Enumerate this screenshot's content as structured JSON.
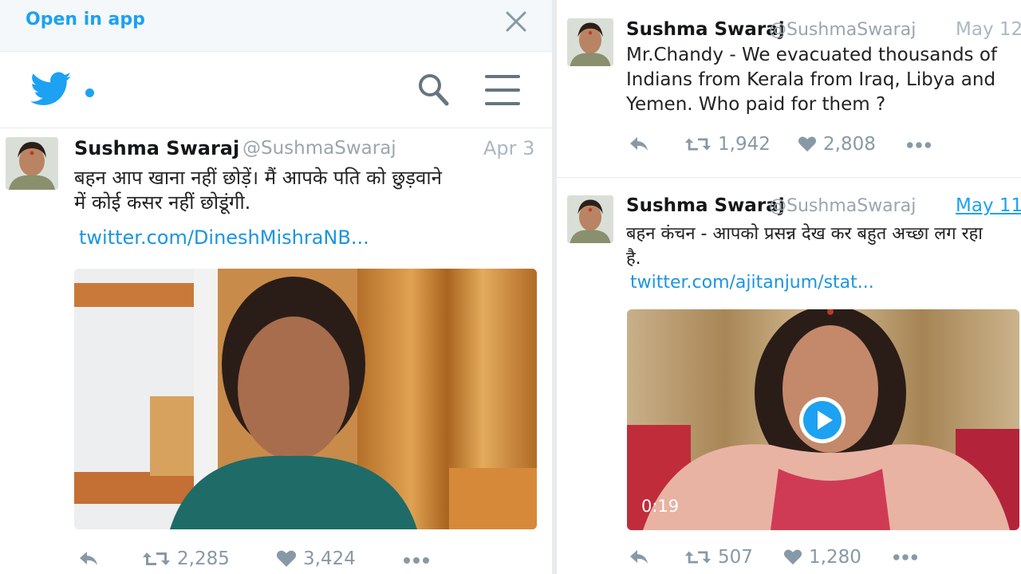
{
  "top_bar": {
    "open_in_app": "Open in app"
  },
  "icons": {
    "close": "close-icon",
    "twitter_bird": "twitter-bird-icon",
    "search": "search-icon",
    "menu": "hamburger-menu-icon",
    "reply": "reply-icon",
    "retweet": "retweet-icon",
    "like": "heart-icon",
    "more": "more-dots-icon",
    "play": "play-icon"
  },
  "colors": {
    "accent": "#1da1f2",
    "link": "#1b95e0",
    "muted": "#8899a6"
  },
  "left_tweet": {
    "author": {
      "name": "Sushma Swaraj",
      "handle": "@SushmaSwaraj"
    },
    "date": "Apr 3",
    "text_line1": "बहन आप खाना नहीं छोड़ें। मैं आपके  पति को छुड़वाने",
    "text_line2": "में कोई कसर नहीं छोडूंगी.",
    "link": "twitter.com/DineshMishraNB...",
    "stats": {
      "retweets": "2,285",
      "likes": "3,424"
    }
  },
  "right_tweets": [
    {
      "author": {
        "name": "Sushma Swaraj",
        "handle": "@SushmaSwaraj"
      },
      "date": "May 12",
      "text_line1": "Mr.Chandy - We evacuated thousands of",
      "text_line2": "Indians from Kerala from Iraq, Libya and",
      "text_line3": "Yemen. Who paid for them ?",
      "stats": {
        "retweets": "1,942",
        "likes": "2,808"
      }
    },
    {
      "author": {
        "name": "Sushma Swaraj",
        "handle": "@SushmaSwaraj"
      },
      "date": "May 11",
      "text_line1": "बहन कंचन - आपको प्रसन्न देख कर बहुत अच्छा लग रहा",
      "text_line2": "है.",
      "link": "twitter.com/ajitanjum/stat...",
      "video_duration": "0:19",
      "stats": {
        "retweets": "507",
        "likes": "1,280"
      }
    }
  ]
}
